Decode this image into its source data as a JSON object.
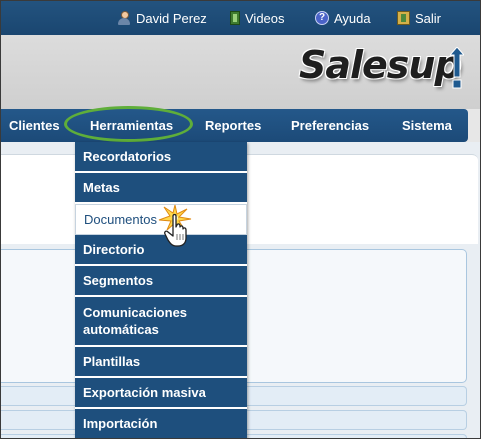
{
  "topbar": {
    "user": {
      "label": "David Perez",
      "icon": "user-icon"
    },
    "videos": {
      "label": "Videos",
      "icon": "film-icon"
    },
    "help": {
      "label": "Ayuda",
      "icon": "help-icon"
    },
    "logout": {
      "label": "Salir",
      "icon": "exit-icon"
    }
  },
  "logo": {
    "text": "Salesup",
    "mark": "!",
    "text_color": "#1f1f1f",
    "mark_color": "#1f5a8f"
  },
  "nav": {
    "items": [
      {
        "label": "Clientes"
      },
      {
        "label": "Herramientas",
        "highlighted": true
      },
      {
        "label": "Reportes"
      },
      {
        "label": "Preferencias"
      },
      {
        "label": "Sistema"
      }
    ],
    "highlight_color": "#5fae3a",
    "bar_color": "#1e4f7d"
  },
  "dropdown": {
    "items": [
      {
        "label": "Recordatorios"
      },
      {
        "label": "Metas"
      },
      {
        "label": "Documentos",
        "active": true
      },
      {
        "label": "Directorio"
      },
      {
        "label": "Segmentos"
      },
      {
        "label": "Comunicaciones automáticas"
      },
      {
        "label": "Plantillas"
      },
      {
        "label": "Exportación masiva"
      },
      {
        "label": "Importación"
      }
    ]
  },
  "cursor": {
    "icon": "hand-pointer-icon"
  }
}
